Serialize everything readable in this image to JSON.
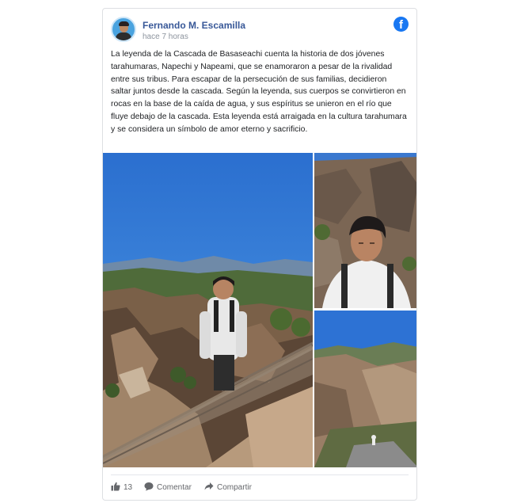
{
  "post": {
    "author": "Fernando M. Escamilla",
    "time": "hace 7 horas",
    "text": "La leyenda de la Cascada de Basaseachi cuenta la historia de dos jóvenes tarahumaras, Napechi y Napeami, que se enamoraron a pesar de la rivalidad entre sus tribus. Para escapar de la persecución de sus familias, decidieron saltar juntos desde la cascada. Según la leyenda, sus cuerpos se convirtieron en rocas en la base de la caída de agua, y sus espíritus se unieron en el río que fluye debajo de la cascada. Esta leyenda está arraigada en la cultura tarahumara y se considera un símbolo de amor eterno y sacrificio."
  },
  "brand": {
    "logo_letter": "f",
    "color": "#1877f2"
  },
  "actions": {
    "likes": "13",
    "comment_label": "Comentar",
    "share_label": "Compartir"
  },
  "icons": {
    "like": "thumbs-up-icon",
    "comment": "comment-icon",
    "share": "share-arrow-icon",
    "logo": "facebook-logo-icon"
  },
  "colors": {
    "author_link": "#385898",
    "sky": "#2f7fd6",
    "rock": "#8a6f58"
  }
}
